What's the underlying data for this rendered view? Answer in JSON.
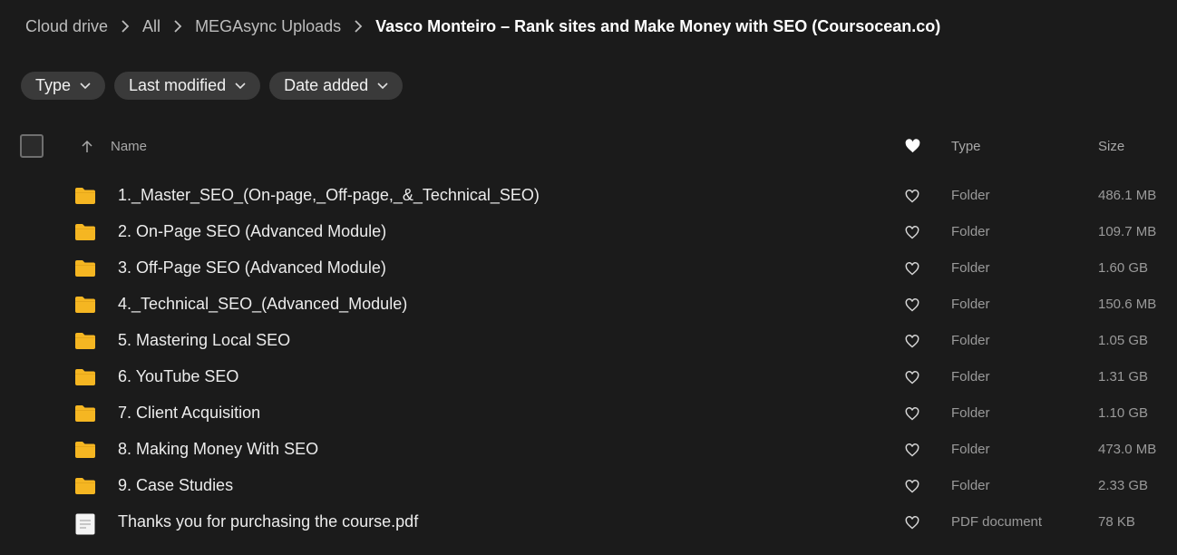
{
  "breadcrumb": {
    "items": [
      "Cloud drive",
      "All",
      "MEGAsync Uploads"
    ],
    "current": "Vasco Monteiro – Rank sites and Make Money with SEO (Coursocean.co)"
  },
  "filters": [
    {
      "label": "Type"
    },
    {
      "label": "Last modified"
    },
    {
      "label": "Date added"
    }
  ],
  "table": {
    "columns": {
      "name": "Name",
      "type": "Type",
      "size": "Size"
    },
    "sort": {
      "column": "name",
      "direction": "ascending"
    },
    "rows": [
      {
        "name": "1._Master_SEO_(On-page,_Off-page,_&_Technical_SEO)",
        "type": "Folder",
        "size": "486.1 MB",
        "icon": "folder-icon"
      },
      {
        "name": "2. On-Page SEO (Advanced Module)",
        "type": "Folder",
        "size": "109.7 MB",
        "icon": "folder-icon"
      },
      {
        "name": "3. Off-Page SEO (Advanced Module)",
        "type": "Folder",
        "size": "1.60 GB",
        "icon": "folder-icon"
      },
      {
        "name": "4._Technical_SEO_(Advanced_Module)",
        "type": "Folder",
        "size": "150.6 MB",
        "icon": "folder-icon"
      },
      {
        "name": "5. Mastering Local SEO",
        "type": "Folder",
        "size": "1.05 GB",
        "icon": "folder-icon"
      },
      {
        "name": "6. YouTube SEO",
        "type": "Folder",
        "size": "1.31 GB",
        "icon": "folder-icon"
      },
      {
        "name": "7. Client Acquisition",
        "type": "Folder",
        "size": "1.10 GB",
        "icon": "folder-icon"
      },
      {
        "name": "8. Making Money With SEO",
        "type": "Folder",
        "size": "473.0 MB",
        "icon": "folder-icon"
      },
      {
        "name": "9. Case Studies",
        "type": "Folder",
        "size": "2.33 GB",
        "icon": "folder-icon"
      },
      {
        "name": "Thanks you for purchasing the course.pdf",
        "type": "PDF document",
        "size": "78 KB",
        "icon": "pdf-file-icon"
      }
    ]
  },
  "colors": {
    "background": "#1b1b1b",
    "chip": "#3a3a3a",
    "folder": "#f5b622",
    "muted_text": "#9a9a9a"
  }
}
